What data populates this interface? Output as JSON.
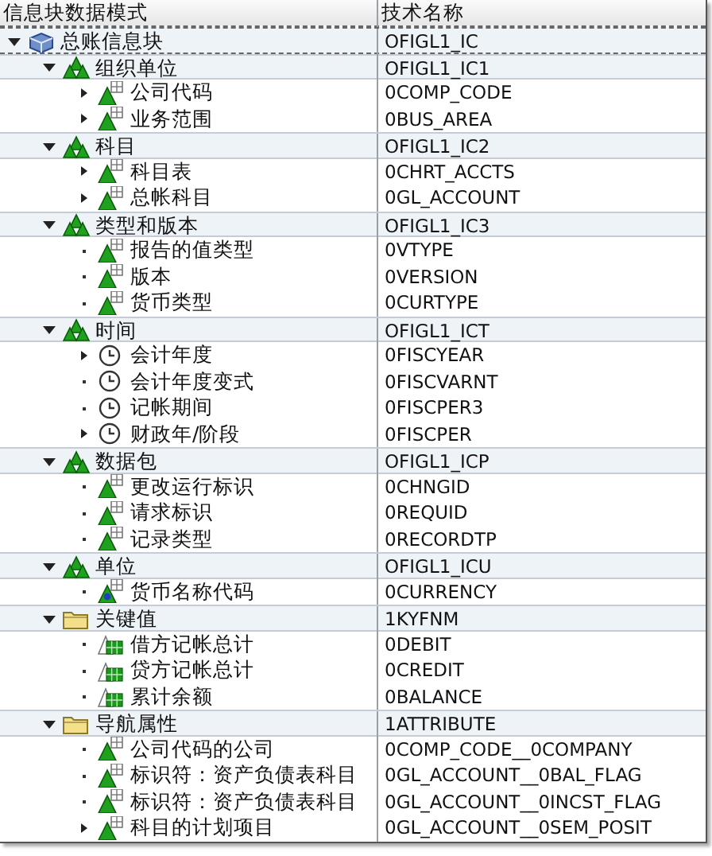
{
  "columns": [
    "信息块数据模式",
    "技术名称"
  ],
  "tree": [
    {
      "name": "总账信息块",
      "technical_name": "OFIGL1_IC",
      "kind": "infocube",
      "expanded": true,
      "children": [
        {
          "name": "组织单位",
          "technical_name": "OFIGL1_IC1",
          "kind": "group",
          "expanded": true,
          "children": [
            {
              "name": "公司代码",
              "technical_name": "0COMP_CODE",
              "kind": "characteristic",
              "expandable": true
            },
            {
              "name": "业务范围",
              "technical_name": "0BUS_AREA",
              "kind": "characteristic",
              "expandable": true
            }
          ]
        },
        {
          "name": "科目",
          "technical_name": "OFIGL1_IC2",
          "kind": "group",
          "expanded": true,
          "children": [
            {
              "name": "科目表",
              "technical_name": "0CHRT_ACCTS",
              "kind": "characteristic",
              "expandable": true
            },
            {
              "name": "总帐科目",
              "technical_name": "0GL_ACCOUNT",
              "kind": "characteristic",
              "expandable": true
            }
          ]
        },
        {
          "name": "类型和版本",
          "technical_name": "OFIGL1_IC3",
          "kind": "group",
          "expanded": true,
          "children": [
            {
              "name": "报告的值类型",
              "technical_name": "0VTYPE",
              "kind": "characteristic",
              "expandable": false
            },
            {
              "name": "版本",
              "technical_name": "0VERSION",
              "kind": "characteristic",
              "expandable": false
            },
            {
              "name": "货币类型",
              "technical_name": "0CURTYPE",
              "kind": "characteristic",
              "expandable": false
            }
          ]
        },
        {
          "name": "时间",
          "technical_name": "OFIGL1_ICT",
          "kind": "group",
          "expanded": true,
          "children": [
            {
              "name": "会计年度",
              "technical_name": "0FISCYEAR",
              "kind": "time",
              "expandable": true
            },
            {
              "name": "会计年度变式",
              "technical_name": "0FISCVARNT",
              "kind": "time",
              "expandable": false
            },
            {
              "name": "记帐期间",
              "technical_name": "0FISCPER3",
              "kind": "time",
              "expandable": false
            },
            {
              "name": "财政年/阶段",
              "technical_name": "0FISCPER",
              "kind": "time",
              "expandable": true
            }
          ]
        },
        {
          "name": "数据包",
          "technical_name": "OFIGL1_ICP",
          "kind": "group",
          "expanded": true,
          "children": [
            {
              "name": "更改运行标识",
              "technical_name": "0CHNGID",
              "kind": "characteristic",
              "expandable": false
            },
            {
              "name": "请求标识",
              "technical_name": "0REQUID",
              "kind": "characteristic",
              "expandable": false
            },
            {
              "name": "记录类型",
              "technical_name": "0RECORDTP",
              "kind": "characteristic",
              "expandable": false
            }
          ]
        },
        {
          "name": "单位",
          "technical_name": "OFIGL1_ICU",
          "kind": "group",
          "expanded": true,
          "children": [
            {
              "name": "货币名称代码",
              "technical_name": "0CURRENCY",
              "kind": "unit",
              "expandable": false
            }
          ]
        },
        {
          "name": "关键值",
          "technical_name": "1KYFNM",
          "kind": "folder",
          "expanded": true,
          "children": [
            {
              "name": "借方记帐总计",
              "technical_name": "0DEBIT",
              "kind": "key_figure",
              "expandable": false
            },
            {
              "name": "贷方记帐总计",
              "technical_name": "0CREDIT",
              "kind": "key_figure",
              "expandable": false
            },
            {
              "name": "累计余额",
              "technical_name": "0BALANCE",
              "kind": "key_figure",
              "expandable": false
            }
          ]
        },
        {
          "name": "导航属性",
          "technical_name": "1ATTRIBUTE",
          "kind": "folder",
          "expanded": true,
          "children": [
            {
              "name": "公司代码的公司",
              "technical_name": "0COMP_CODE__0COMPANY",
              "kind": "characteristic",
              "expandable": false
            },
            {
              "name": "标识符：资产负债表科目",
              "technical_name": "0GL_ACCOUNT__0BAL_FLAG",
              "kind": "characteristic",
              "expandable": false
            },
            {
              "name": "标识符：资产负债表科目",
              "technical_name": "0GL_ACCOUNT__0INCST_FLAG",
              "kind": "characteristic",
              "expandable": false
            },
            {
              "name": "科目的计划项目",
              "technical_name": "0GL_ACCOUNT__0SEM_POSIT",
              "kind": "characteristic",
              "expandable": true
            }
          ]
        }
      ]
    }
  ]
}
